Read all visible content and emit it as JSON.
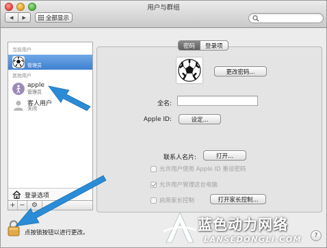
{
  "window": {
    "title": "用户与群组",
    "show_all_label": "全部显示",
    "nav_back": "◀",
    "nav_forward": "▶"
  },
  "search": {
    "placeholder": ""
  },
  "sidebar": {
    "current_user_heading": "当前用户",
    "current_user": {
      "name": "",
      "role": "管理员",
      "avatar": "soccer-ball"
    },
    "other_users_heading": "其他用户",
    "other_users": [
      {
        "name": "apple",
        "role": "管理员",
        "avatar": "purple-figure"
      },
      {
        "name": "客人用户",
        "role": "关闭",
        "avatar": "person-silhouette"
      }
    ],
    "login_options_label": "登录选项",
    "add_button": "+",
    "remove_button": "−",
    "actions_button": "⚙"
  },
  "tabs": [
    {
      "label": "密码",
      "active": true
    },
    {
      "label": "登录项",
      "active": false
    }
  ],
  "panel": {
    "change_password_button": "更改密码...",
    "full_name_label": "全名:",
    "full_name_value": "",
    "apple_id_label": "Apple ID:",
    "apple_id_button": "设定...",
    "contact_card_label": "联系人名片:",
    "contact_card_button": "打开...",
    "checkboxes": [
      {
        "label": "允许用户使用 Apple ID 重设密码",
        "checked": false,
        "enabled": false
      },
      {
        "label": "允许用户管理这台电脑",
        "checked": true,
        "enabled": false
      },
      {
        "label": "启用家长控制",
        "checked": false,
        "enabled": false
      }
    ],
    "parental_controls_button": "打开家长控制..."
  },
  "footer": {
    "lock_text": "点按锁按钮以进行更改。",
    "help_button": "?"
  },
  "watermark": {
    "chinese": "蓝色动力网络",
    "english": "LANSEDONGLI.COM"
  },
  "colors": {
    "selection": "#3f7fd0",
    "arrow": "#2a8cd6"
  }
}
